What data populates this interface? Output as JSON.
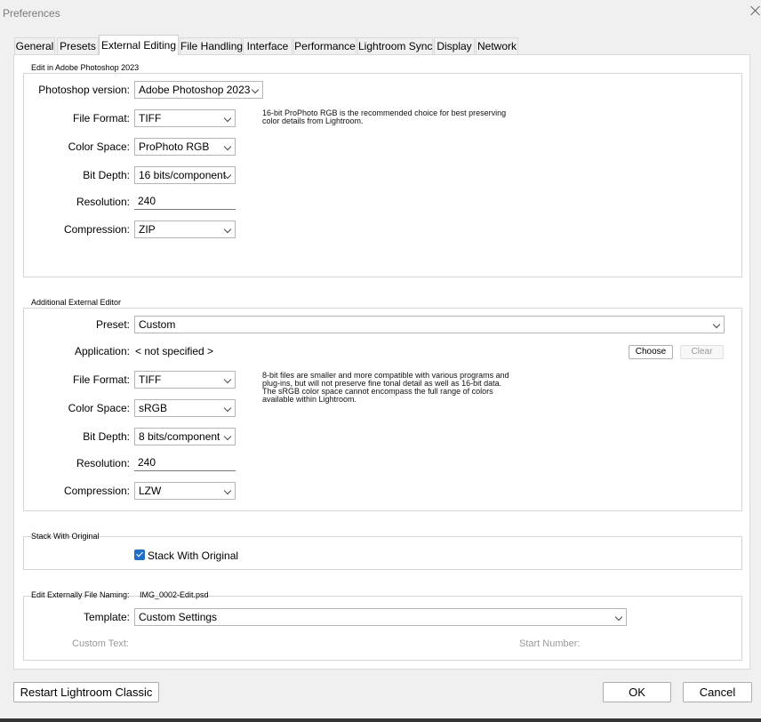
{
  "window": {
    "title": "Preferences"
  },
  "tabs": [
    {
      "label": "General"
    },
    {
      "label": "Presets"
    },
    {
      "label": "External Editing",
      "active": true
    },
    {
      "label": "File Handling"
    },
    {
      "label": "Interface"
    },
    {
      "label": "Performance"
    },
    {
      "label": "Lightroom Sync"
    },
    {
      "label": "Display"
    },
    {
      "label": "Network"
    }
  ],
  "photoshop": {
    "group_title": "Edit in Adobe Photoshop 2023",
    "version_label": "Photoshop version:",
    "version_value": "Adobe Photoshop 2023",
    "file_format_label": "File Format:",
    "file_format_value": "TIFF",
    "color_space_label": "Color Space:",
    "color_space_value": "ProPhoto RGB",
    "bit_depth_label": "Bit Depth:",
    "bit_depth_value": "16 bits/component",
    "resolution_label": "Resolution:",
    "resolution_value": "240",
    "compression_label": "Compression:",
    "compression_value": "ZIP",
    "note_line1": "16-bit ProPhoto RGB is the recommended choice for best preserving",
    "note_line2": "color details from Lightroom."
  },
  "additional": {
    "group_title": "Additional External Editor",
    "preset_label": "Preset:",
    "preset_value": "Custom",
    "application_label": "Application:",
    "application_value": "< not specified >",
    "choose_label": "Choose",
    "clear_label": "Clear",
    "file_format_label": "File Format:",
    "file_format_value": "TIFF",
    "color_space_label": "Color Space:",
    "color_space_value": "sRGB",
    "bit_depth_label": "Bit Depth:",
    "bit_depth_value": "8 bits/component",
    "resolution_label": "Resolution:",
    "resolution_value": "240",
    "compression_label": "Compression:",
    "compression_value": "LZW",
    "note_line1": "8-bit files are smaller and more compatible with various programs and",
    "note_line2": "plug-ins, but will not preserve fine tonal detail as well as 16-bit data.",
    "note_line3": "The sRGB color space cannot encompass the full range of colors",
    "note_line4": "available within Lightroom."
  },
  "stack": {
    "group_title": "Stack With Original",
    "checkbox_label": "Stack With Original",
    "checked": true
  },
  "naming": {
    "group_title": "Edit Externally File Naming:",
    "example_filename": "IMG_0002-Edit.psd",
    "template_label": "Template:",
    "template_value": "Custom Settings",
    "custom_text_label": "Custom Text:",
    "start_number_label": "Start Number:"
  },
  "footer": {
    "restart_label": "Restart Lightroom Classic",
    "ok_label": "OK",
    "cancel_label": "Cancel"
  }
}
